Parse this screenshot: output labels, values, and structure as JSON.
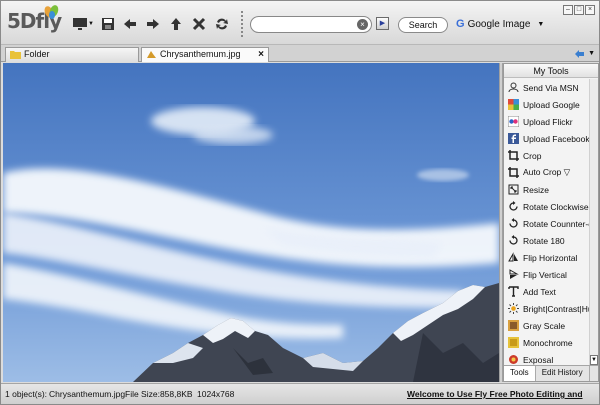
{
  "app": {
    "logo_text": "5Dfly"
  },
  "toolbar": {
    "search_value": "",
    "search_button": "Search",
    "engine_label": "Google Image",
    "engine_g": "G"
  },
  "tabs": [
    {
      "label": "Folder"
    },
    {
      "label": "Chrysanthemum.jpg"
    }
  ],
  "panel": {
    "title": "My Tools",
    "tools": [
      {
        "label": "Send Via MSN",
        "icon": "msn-icon"
      },
      {
        "label": "Upload Google",
        "icon": "google-upload-icon"
      },
      {
        "label": "Upload Flickr",
        "icon": "flickr-icon"
      },
      {
        "label": "Upload Facebook",
        "icon": "facebook-icon"
      },
      {
        "label": "Crop",
        "icon": "crop-icon"
      },
      {
        "label": "Auto Crop ▽",
        "icon": "auto-crop-icon"
      },
      {
        "label": "Resize",
        "icon": "resize-icon"
      },
      {
        "label": "Rotate Clockwise",
        "icon": "rotate-clockwise-icon"
      },
      {
        "label": "Rotate Counnter-clock",
        "icon": "rotate-counterclockwise-icon"
      },
      {
        "label": "Rotate 180",
        "icon": "rotate-180-icon"
      },
      {
        "label": "Flip Horizontal",
        "icon": "flip-horizontal-icon"
      },
      {
        "label": "Flip Vertical",
        "icon": "flip-vertical-icon"
      },
      {
        "label": "Add Text",
        "icon": "text-icon"
      },
      {
        "label": "Bright|Contrast|Hue",
        "icon": "brightness-icon"
      },
      {
        "label": "Gray Scale",
        "icon": "grayscale-icon"
      },
      {
        "label": "Monochrome",
        "icon": "monochrome-icon"
      },
      {
        "label": "Exposal",
        "icon": "exposure-icon"
      }
    ],
    "bottom_tabs": [
      "Tools",
      "Edit History"
    ]
  },
  "status": {
    "objects": "1 object(s):",
    "filename": "Chrysanthemum.jpg",
    "filesize": "File Size:858,8KB",
    "dimensions": "1024x768",
    "welcome": "Welcome to Use Fly Free Photo Editing and Viewer."
  },
  "colors": {
    "sky": "#4a7cc4",
    "accent": "#2a5bb8"
  }
}
